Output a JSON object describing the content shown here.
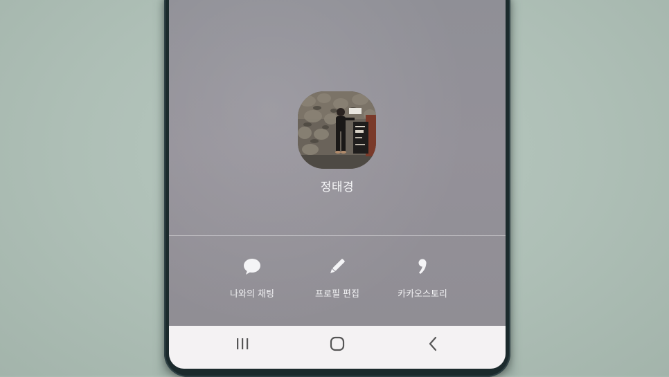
{
  "profile": {
    "name": "정태경"
  },
  "actions": [
    {
      "label": "나와의 채팅",
      "icon": "chat-bubble-icon"
    },
    {
      "label": "프로필 편집",
      "icon": "pencil-icon"
    },
    {
      "label": "카카오스토리",
      "icon": "comma-icon"
    }
  ],
  "navbar": {
    "recents_icon": "recents-icon",
    "home_icon": "home-icon",
    "back_icon": "back-icon"
  },
  "colors": {
    "screen_background": "#8f8f96",
    "text": "#f4f4f6",
    "navbar_background": "#f4f2f3",
    "navbar_icon": "#555555"
  }
}
